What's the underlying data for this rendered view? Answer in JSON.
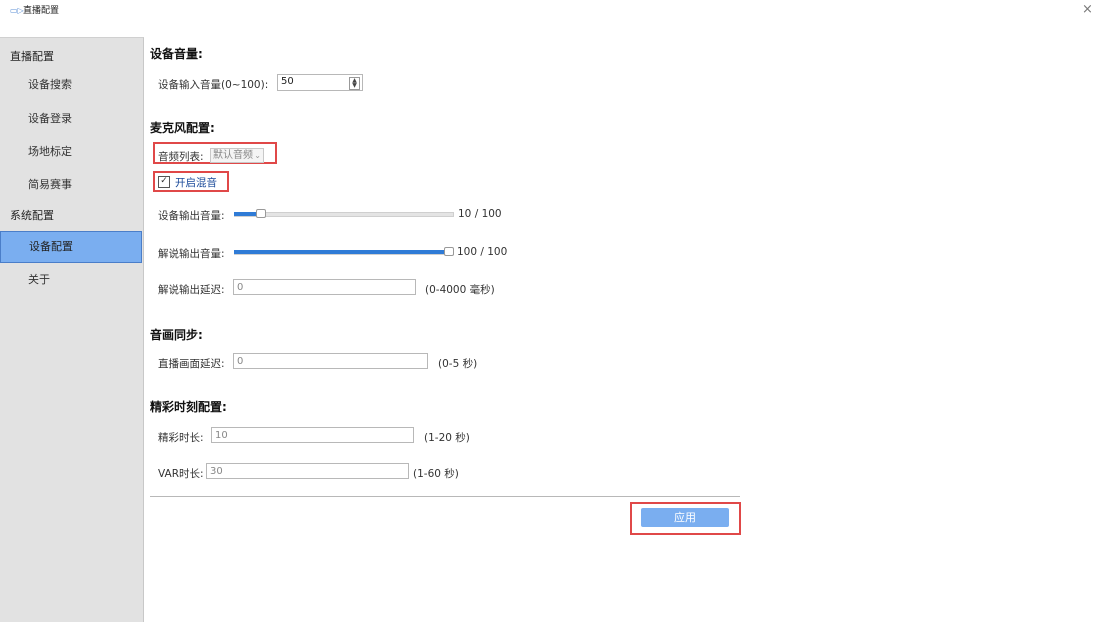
{
  "window": {
    "title": "直播配置",
    "close_glyph": "×"
  },
  "sidebar": {
    "groups": [
      {
        "label": "直播配置",
        "items": [
          {
            "label": "设备搜索"
          },
          {
            "label": "设备登录"
          },
          {
            "label": "场地标定"
          },
          {
            "label": "简易赛事"
          }
        ]
      },
      {
        "label": "系统配置",
        "items": [
          {
            "label": "设备配置",
            "active": true
          },
          {
            "label": "关于"
          }
        ]
      }
    ]
  },
  "device_volume": {
    "title": "设备音量:",
    "input_label": "设备输入音量(0~100):",
    "input_value": "50"
  },
  "mic": {
    "title": "麦克风配置:",
    "audio_list_label": "音频列表:",
    "audio_list_value": "默认音频",
    "mix_checkbox_label": "开启混音",
    "mix_checked": true,
    "output_volume_label": "设备输出音量:",
    "output_volume_value": 10,
    "output_volume_text": "10 / 100",
    "commentary_volume_label": "解说输出音量:",
    "commentary_volume_value": 100,
    "commentary_volume_text": "100 / 100",
    "commentary_delay_label": "解说输出延迟:",
    "commentary_delay_value": "0",
    "commentary_delay_note": "(0-4000 毫秒)"
  },
  "av_sync": {
    "title": "音画同步:",
    "live_delay_label": "直播画面延迟:",
    "live_delay_value": "0",
    "live_delay_note": "(0-5 秒)"
  },
  "highlight": {
    "title": "精彩时刻配置:",
    "duration_label": "精彩时长:",
    "duration_value": "10",
    "duration_note": "(1-20 秒)",
    "var_label": "VAR时长:",
    "var_value": "30",
    "var_note": "(1-60 秒)"
  },
  "apply_label": "应用",
  "colors": {
    "accent": "#7aaef0",
    "highlight_box": "#e04848",
    "slider_fill": "#2f7bd6"
  }
}
